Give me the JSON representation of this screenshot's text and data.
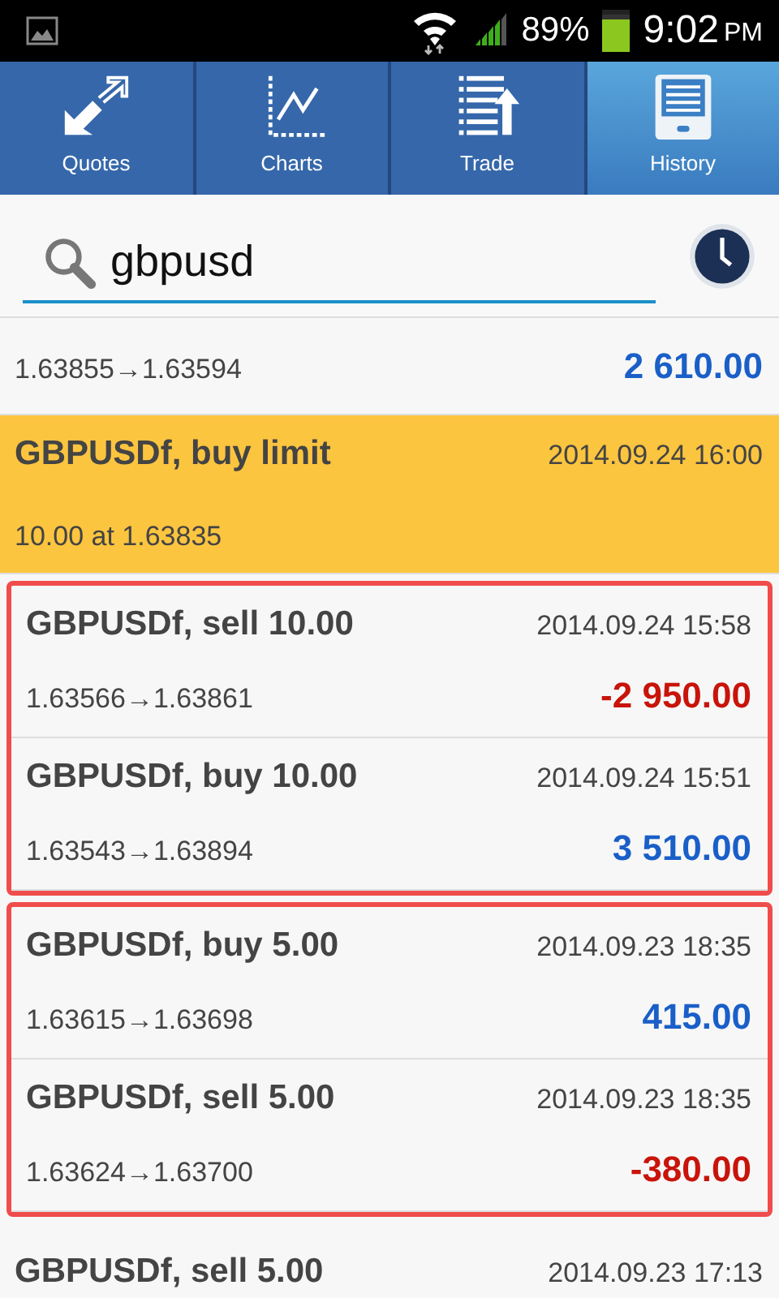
{
  "status_bar": {
    "battery": "89%",
    "time": "9:02",
    "ampm": "PM"
  },
  "tabs": [
    {
      "label": "Quotes",
      "selected": false
    },
    {
      "label": "Charts",
      "selected": false
    },
    {
      "label": "Trade",
      "selected": false
    },
    {
      "label": "History",
      "selected": true
    }
  ],
  "search": {
    "value": "gbpusd"
  },
  "groups": [
    {
      "highlighted": false,
      "items": [
        {
          "kind": "deal",
          "prices": "1.63855→1.63594",
          "profit": "2 610.00",
          "color": "#1a5fc8"
        },
        {
          "kind": "order",
          "title": "GBPUSDf, buy limit",
          "time": "2014.09.24 16:00",
          "detail": "10.00 at 1.63835"
        }
      ]
    },
    {
      "highlighted": true,
      "items": [
        {
          "kind": "deal",
          "title": "GBPUSDf, sell 10.00",
          "time": "2014.09.24 15:58",
          "prices": "1.63566→1.63861",
          "profit": "-2 950.00",
          "color": "#c8140a"
        },
        {
          "kind": "deal",
          "title": "GBPUSDf, buy 10.00",
          "time": "2014.09.24 15:51",
          "prices": "1.63543→1.63894",
          "profit": "3 510.00",
          "color": "#1a5fc8"
        }
      ]
    },
    {
      "highlighted": true,
      "items": [
        {
          "kind": "deal",
          "title": "GBPUSDf, buy 5.00",
          "time": "2014.09.23 18:35",
          "prices": "1.63615→1.63698",
          "profit": "415.00",
          "color": "#1a5fc8"
        },
        {
          "kind": "deal",
          "title": "GBPUSDf, sell 5.00",
          "time": "2014.09.23 18:35",
          "prices": "1.63624→1.63700",
          "profit": "-380.00",
          "color": "#c8140a"
        }
      ]
    },
    {
      "highlighted": false,
      "items": [
        {
          "kind": "deal",
          "title": "GBPUSDf, sell 5.00",
          "time": "2014.09.23 17:13"
        }
      ]
    }
  ]
}
